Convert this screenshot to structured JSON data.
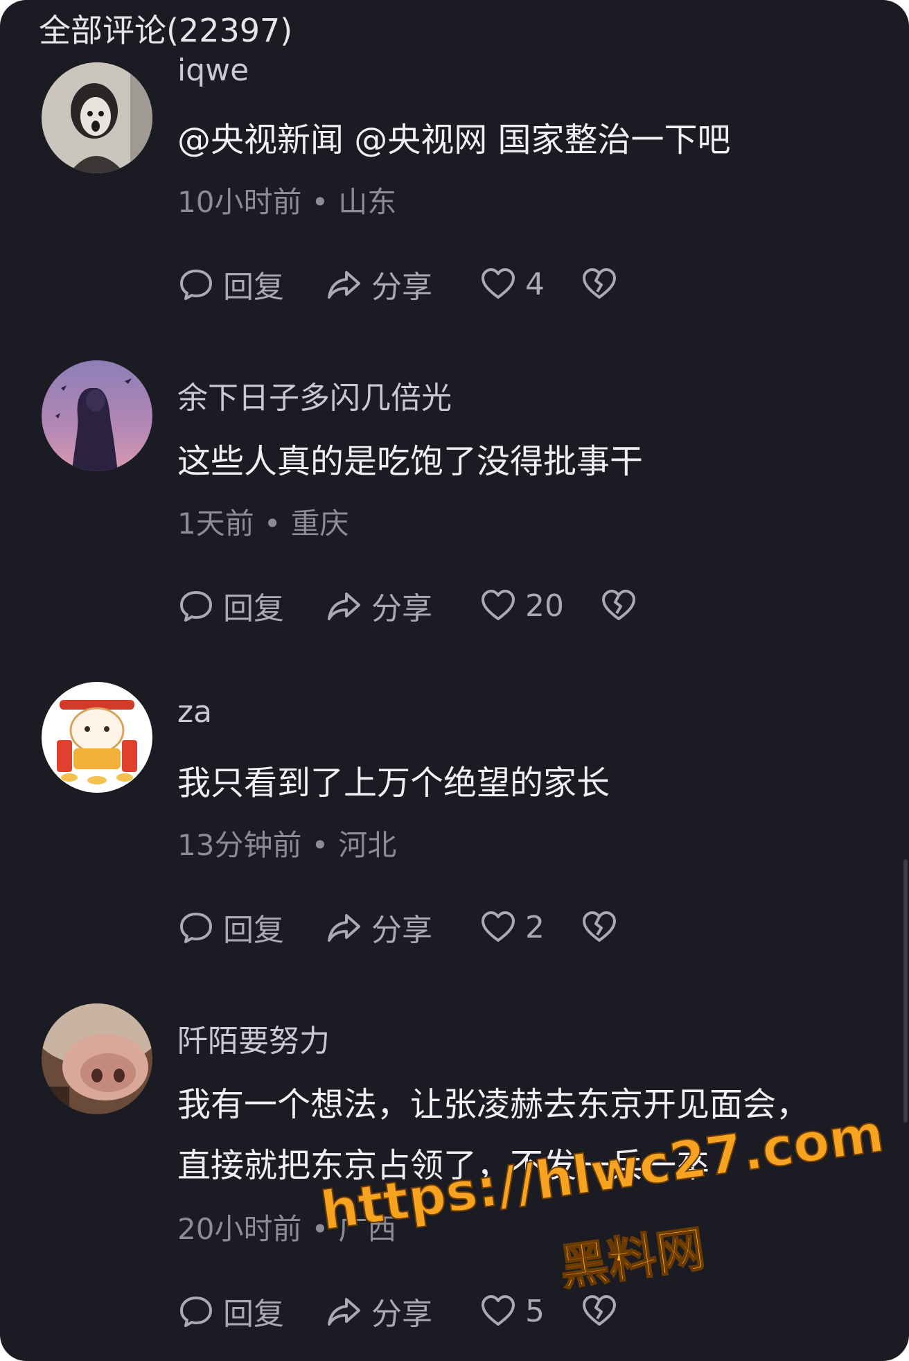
{
  "header": {
    "title": "全部评论(22397)"
  },
  "labels": {
    "reply": "回复",
    "share": "分享",
    "dot": "•"
  },
  "comments": [
    {
      "username": "iqwe",
      "content_lines": [
        "@央视新闻 @央视网 国家整治一下吧"
      ],
      "time": "10小时前",
      "location": "山东",
      "likes": "4"
    },
    {
      "username": "余下日子多闪几倍光",
      "content_lines": [
        "这些人真的是吃饱了没得批事干"
      ],
      "time": "1天前",
      "location": "重庆",
      "likes": "20"
    },
    {
      "username": "za",
      "content_lines": [
        "我只看到了上万个绝望的家长"
      ],
      "time": "13分钟前",
      "location": "河北",
      "likes": "2"
    },
    {
      "username": "阡陌要努力",
      "content_lines": [
        "我有一个想法，让张凌赫去东京开见面会，",
        "直接就把东京占领了，不发一兵一卒"
      ],
      "time": "20小时前",
      "location": "广西",
      "likes": "5"
    }
  ],
  "watermark": {
    "url": "https://hlwc27.com",
    "site": "黑料网"
  },
  "colors": {
    "background": "#1a1b23",
    "primary_text": "#f0f0f3",
    "secondary_text": "#8b8c96",
    "watermark": "#f5a320"
  },
  "icons": {
    "reply": "speech-bubble-icon",
    "share": "share-arrow-icon",
    "like": "heart-outline-icon",
    "dislike": "broken-heart-icon"
  }
}
